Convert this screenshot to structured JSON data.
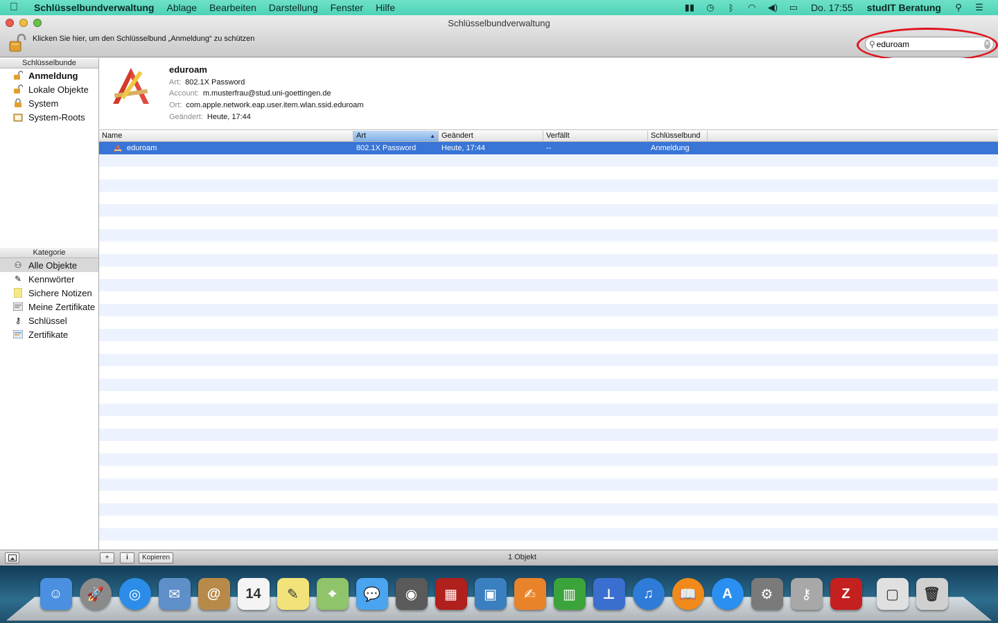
{
  "menubar": {
    "app_name": "Schlüsselbundverwaltung",
    "menus": [
      "Ablage",
      "Bearbeiten",
      "Darstellung",
      "Fenster",
      "Hilfe"
    ],
    "clock": "Do. 17:55",
    "user": "studIT Beratung"
  },
  "window": {
    "title": "Schlüsselbundverwaltung",
    "lock_message": "Klicken Sie hier, um den Schlüsselbund „Anmeldung“ zu schützen",
    "search_value": "eduroam"
  },
  "sidebar": {
    "keychains_header": "Schlüsselbunde",
    "keychains": [
      {
        "label": "Anmeldung",
        "icon": "lock-open-icon"
      },
      {
        "label": "Lokale Objekte",
        "icon": "lock-open-icon"
      },
      {
        "label": "System",
        "icon": "lock-closed-icon"
      },
      {
        "label": "System-Roots",
        "icon": "folder-icon"
      }
    ],
    "category_header": "Kategorie",
    "categories": [
      {
        "label": "Alle Objekte",
        "icon": "all-items-icon"
      },
      {
        "label": "Kennwörter",
        "icon": "password-icon"
      },
      {
        "label": "Sichere Notizen",
        "icon": "note-icon"
      },
      {
        "label": "Meine Zertifikate",
        "icon": "certificate-icon"
      },
      {
        "label": "Schlüssel",
        "icon": "key-icon"
      },
      {
        "label": "Zertifikate",
        "icon": "certificate-icon"
      }
    ]
  },
  "detail": {
    "name": "eduroam",
    "art_label": "Art:",
    "art_value": "802.1X Password",
    "account_label": "Account:",
    "account_value": "m.musterfrau@stud.uni-goettingen.de",
    "ort_label": "Ort:",
    "ort_value": "com.apple.network.eap.user.item.wlan.ssid.eduroam",
    "geaendert_label": "Geändert:",
    "geaendert_value": "Heute, 17:44"
  },
  "table": {
    "columns": [
      "Name",
      "Art",
      "Geändert",
      "Verfällt",
      "Schlüsselbund"
    ],
    "rows": [
      {
        "name": "eduroam",
        "art": "802.1X Password",
        "geaendert": "Heute, 17:44",
        "verfaellt": "--",
        "schluesselbund": "Anmeldung"
      }
    ]
  },
  "bottombar": {
    "add_label": "+",
    "info_label": "i",
    "copy_label": "Kopieren",
    "status": "1 Objekt"
  },
  "colors": {
    "menubar": "#4fd3b8",
    "selection": "#3875d7",
    "stripe": "#edf3fe",
    "highlight_circle": "#e0121e"
  },
  "dock": [
    {
      "name": "finder-icon",
      "glyph": "☺",
      "color": "#4a8fe0"
    },
    {
      "name": "launchpad-icon",
      "glyph": "🚀",
      "color": "#8a8a8a"
    },
    {
      "name": "safari-icon",
      "glyph": "◎",
      "color": "#2b8de8"
    },
    {
      "name": "mail-icon",
      "glyph": "✉",
      "color": "#5f8fc9"
    },
    {
      "name": "contacts-icon",
      "glyph": "@",
      "color": "#b88a4a"
    },
    {
      "name": "calendar-icon",
      "glyph": "14",
      "color": "#f4f4f4"
    },
    {
      "name": "notes-icon",
      "glyph": "✎",
      "color": "#f2e27a"
    },
    {
      "name": "maps-icon",
      "glyph": "⌖",
      "color": "#8fc46a"
    },
    {
      "name": "messages-icon",
      "glyph": "💬",
      "color": "#4aa4f0"
    },
    {
      "name": "facetime-icon",
      "glyph": "◉",
      "color": "#5a5a5a"
    },
    {
      "name": "photobooth-icon",
      "glyph": "▦",
      "color": "#b0201c"
    },
    {
      "name": "iphoto-icon",
      "glyph": "▣",
      "color": "#3a7fbf"
    },
    {
      "name": "pages-icon",
      "glyph": "✍",
      "color": "#e9832a"
    },
    {
      "name": "numbers-icon",
      "glyph": "▥",
      "color": "#3aa43a"
    },
    {
      "name": "keynote-icon",
      "glyph": "⊥",
      "color": "#3a6fcf"
    },
    {
      "name": "itunes-icon",
      "glyph": "♫",
      "color": "#2e7bd8"
    },
    {
      "name": "ibooks-icon",
      "glyph": "📖",
      "color": "#f08a1a"
    },
    {
      "name": "appstore-icon",
      "glyph": "A",
      "color": "#2a8ff0"
    },
    {
      "name": "system-preferences-icon",
      "glyph": "⚙",
      "color": "#7a7a7a"
    },
    {
      "name": "keychain-access-icon",
      "glyph": "⚷",
      "color": "#a8a8a8"
    },
    {
      "name": "filezilla-icon",
      "glyph": "Z",
      "color": "#c42020"
    },
    {
      "name": "applications-folder-icon",
      "glyph": "▢",
      "color": "#e0e0e0"
    },
    {
      "name": "trash-icon",
      "glyph": "🗑",
      "color": "#d0d0d0"
    }
  ]
}
